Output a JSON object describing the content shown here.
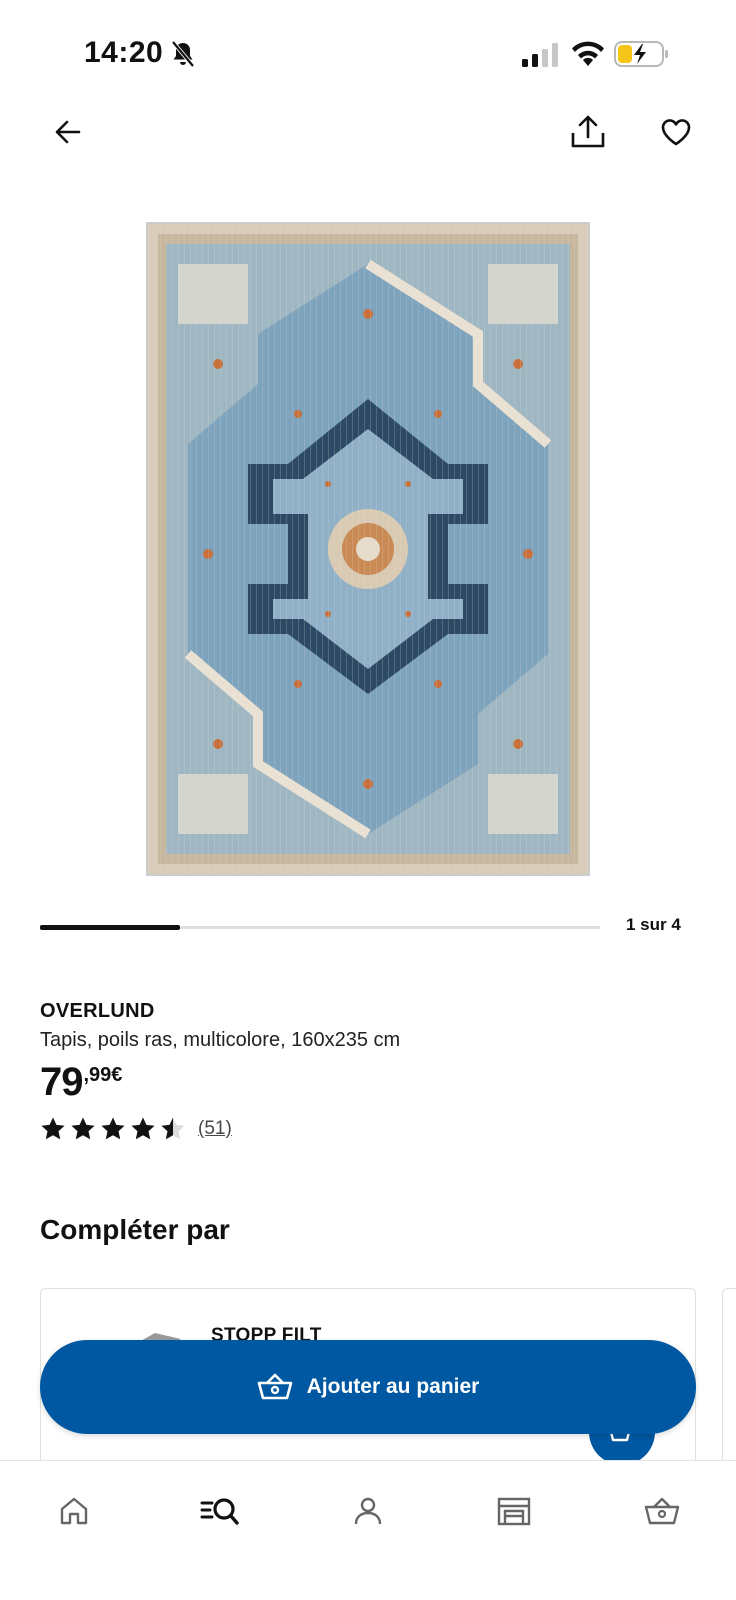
{
  "status_bar": {
    "time": "14:20",
    "icons": [
      "bell-slash-icon",
      "cellular-signal-icon",
      "wifi-icon",
      "battery-charging-icon"
    ],
    "battery_color": "#f5c518"
  },
  "top_nav": {
    "icons": [
      "arrow-left-icon",
      "share-icon",
      "heart-icon"
    ]
  },
  "gallery": {
    "current_page_fraction": 0.25,
    "counter": "1 sur 4"
  },
  "product": {
    "name": "OVERLUND",
    "description": "Tapis, poils ras, multicolore, 160x235 cm",
    "price_integer": "79",
    "price_decimal": ",99€",
    "rating_value": 4.5,
    "rating_max": 5,
    "review_count": "(51)"
  },
  "recommendations": {
    "title": "Compléter par",
    "items": [
      {
        "name": "STOPP FILT"
      }
    ]
  },
  "cta": {
    "label": "Ajouter au panier",
    "icon": "basket-icon"
  },
  "bottom_nav": {
    "tabs": [
      {
        "icon": "home-icon",
        "active": false
      },
      {
        "icon": "search-list-icon",
        "active": true
      },
      {
        "icon": "profile-icon",
        "active": false
      },
      {
        "icon": "store-icon",
        "active": false
      },
      {
        "icon": "basket-icon",
        "active": false
      }
    ]
  },
  "colors": {
    "primary_blue": "#0058a3",
    "text": "#111111",
    "border": "#dfdfdf"
  }
}
